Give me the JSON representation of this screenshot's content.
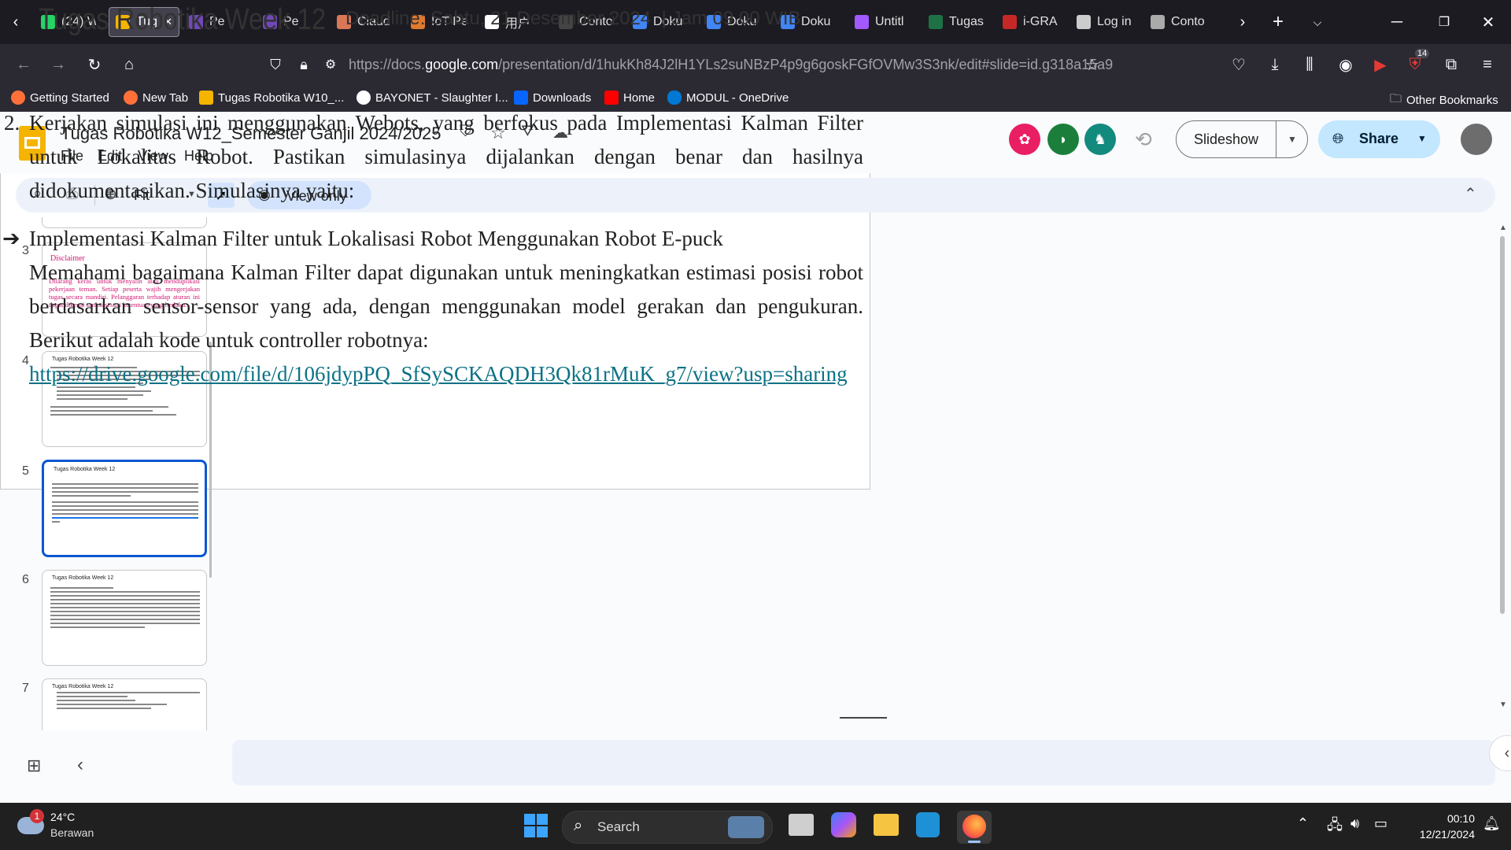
{
  "browser": {
    "tabs": [
      {
        "label": "(24) W",
        "color": "#25d366",
        "icon": "whatsapp-icon"
      },
      {
        "label": "Tugas",
        "color": "#f4b400",
        "icon": "slides-icon",
        "active": true
      },
      {
        "label": "Pe",
        "color": "#7248b9",
        "icon": "pin-icon"
      },
      {
        "label": "Pe",
        "color": "#7248b9",
        "icon": "pin-icon"
      },
      {
        "label": "Claud",
        "color": "#d97757",
        "icon": "claude-icon"
      },
      {
        "label": "IoT Pe",
        "color": "#e07a2f",
        "icon": "iot-icon"
      },
      {
        "label": "用户",
        "color": "#ffffff",
        "icon": "openai-icon"
      },
      {
        "label": "Contoh_C",
        "color": "#444444",
        "icon": "page-icon"
      },
      {
        "label": "Doku",
        "color": "#4285f4",
        "icon": "docs-icon"
      },
      {
        "label": "Doku",
        "color": "#4285f4",
        "icon": "docs-icon"
      },
      {
        "label": "Doku",
        "color": "#4285f4",
        "icon": "docs-icon"
      },
      {
        "label": "Untitl",
        "color": "#a259ff",
        "icon": "figma-icon"
      },
      {
        "label": "Tugas",
        "color": "#1e7145",
        "icon": "excel-icon"
      },
      {
        "label": "i-GRA",
        "color": "#c62828",
        "icon": "igracias-icon"
      },
      {
        "label": "Log in",
        "color": "#cccccc",
        "icon": "github-icon"
      },
      {
        "label": "Conto",
        "color": "#aaaaaa",
        "icon": "chatgpt-icon"
      }
    ],
    "url_prefix": "https://docs.",
    "url_host": "google.com",
    "url_rest": "/presentation/d/1hukKh84J2lH1YLs2suNBzP4p9g6goskFGfOVMw3S3nk/edit#slide=id.g318a15a9",
    "extension_badge": "14",
    "bookmarks": [
      "Getting Started",
      "New Tab",
      "Tugas Robotika W10_...",
      "BAYONET - Slaughter I...",
      "Downloads",
      "Home",
      "MODUL - OneDrive"
    ],
    "other_bookmarks": "Other Bookmarks"
  },
  "doc": {
    "title": "Tugas Robotika W12_Semester Ganjil 2024/2025",
    "menus": [
      "File",
      "Edit",
      "View",
      "Help"
    ],
    "slideshow_label": "Slideshow",
    "share_label": "Share",
    "zoom_label": "Fit",
    "view_only_label": "View only"
  },
  "filmstrip": {
    "slides": [
      {
        "num": "3",
        "title": "Disclaimer",
        "text": "Dilarang keras untuk menyalin atau menduplikasi pekerjaan teman. Setiap peserta wajib mengerjakan tugas secara mandiri. Pelanggaran terhadap aturan ini dapat dikenai sanksi sesuai ketentuan yang berlaku."
      },
      {
        "num": "4",
        "title": "Tugas Robotika Week 12"
      },
      {
        "num": "5",
        "title": "Tugas Robotika Week 12"
      },
      {
        "num": "6",
        "title": "Tugas Robotika Week 12"
      },
      {
        "num": "7",
        "title": "Tugas Robotika Week 12"
      }
    ]
  },
  "slide": {
    "heading": "Tugas Robotika Week 12",
    "deadline": "Deadline: Sabtu, 21 Desember 2024  | Jam 09.00 WIB",
    "item_num": "2.",
    "item_text": "Kerjakan simulasi ini menggunakan Webots, yang berfokus pada Implementasi Kalman Filter untuk Lokalitas Robot. Pastikan simulasinya dijalankan dengan benar dan hasilnya didokumentasikan. Simulasinya yaitu:",
    "arrow": "➔",
    "bullet_title": "Implementasi Kalman Filter untuk Lokalisasi Robot Menggunakan Robot E-puck",
    "bullet_text": "Memahami bagaimana Kalman Filter dapat digunakan untuk meningkatkan estimasi posisi robot berdasarkan sensor-sensor yang ada, dengan menggunakan model gerakan dan pengukuran. Berikut adalah kode untuk controller robotnya:",
    "link": "https://drive.google.com/file/d/106jdypPQ_SfSySCKAQDH3Qk81rMuK_g7/view?usp=sharing"
  },
  "taskbar": {
    "weather_temp": "24°C",
    "weather_desc": "Berawan",
    "weather_badge": "1",
    "search_label": "Search",
    "time": "00:10",
    "date": "12/21/2024"
  }
}
